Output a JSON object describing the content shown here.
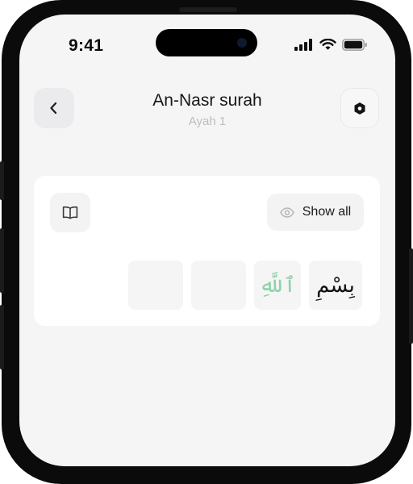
{
  "status": {
    "time": "9:41"
  },
  "header": {
    "title": "An-Nasr surah",
    "subtitle": "Ayah 1"
  },
  "card": {
    "show_all_label": "Show all",
    "words": [
      "",
      "",
      "ٱللَّهِ",
      "بِسْمِ"
    ],
    "word_colors": [
      "",
      "",
      "#8fd2aa",
      "#111111"
    ]
  },
  "icons": [
    "chevron-left-icon",
    "settings-hexagon-icon",
    "book-icon",
    "eye-icon",
    "cellular-signal-icon",
    "wifi-icon",
    "battery-icon"
  ]
}
